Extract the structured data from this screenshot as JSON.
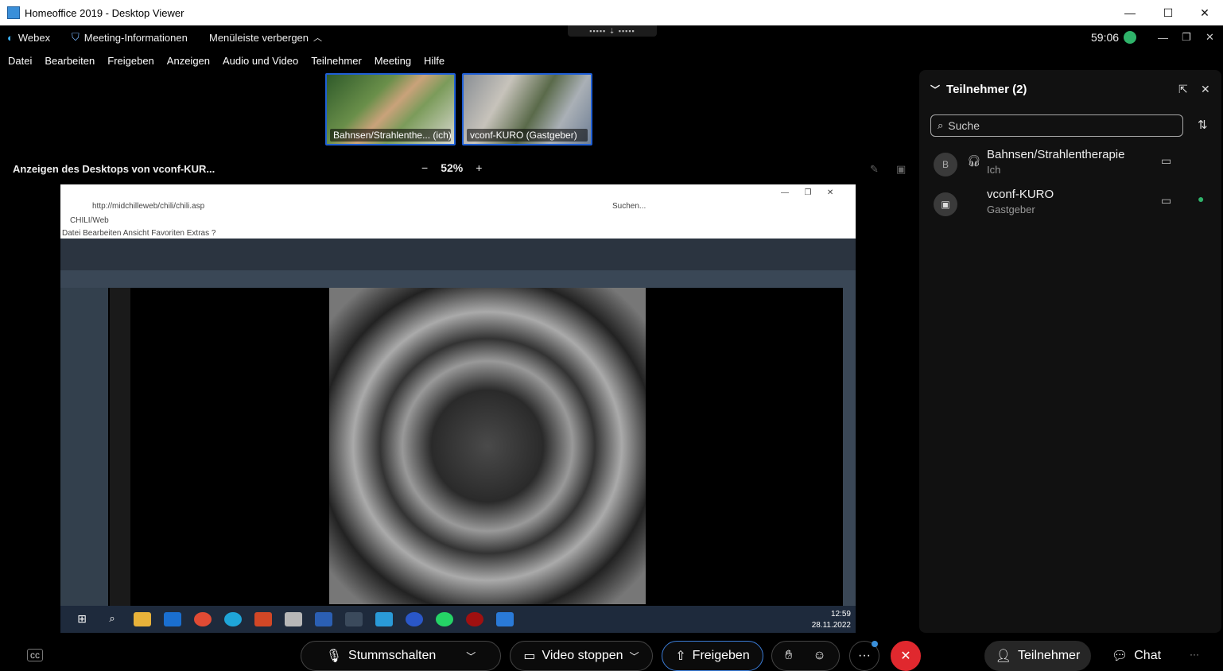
{
  "window": {
    "title": "Homeoffice 2019 - Desktop Viewer",
    "minimize": "—",
    "maximize": "☐",
    "close": "✕"
  },
  "webexbar": {
    "brand": "Webex",
    "meeting_info": "Meeting-Informationen",
    "hide_menu": "Menüleiste verbergen",
    "timer": "59:06"
  },
  "menu": [
    "Datei",
    "Bearbeiten",
    "Freigeben",
    "Anzeigen",
    "Audio und Video",
    "Teilnehmer",
    "Meeting",
    "Hilfe"
  ],
  "thumbnails": [
    {
      "label": "Bahnsen/Strahlenthe... (ich)"
    },
    {
      "label": "vconf-KURO (Gastgeber)"
    }
  ],
  "share": {
    "title": "Anzeigen des Desktops von vconf-KUR...",
    "zoom_out": "−",
    "zoom_level": "52%",
    "zoom_in": "+"
  },
  "shared_screen": {
    "url": "http://midchilleweb/chili/chili.asp",
    "app_title": "CHILI/Web",
    "search": "Suchen...",
    "menu": "Datei  Bearbeiten  Ansicht  Favoriten  Extras  ?",
    "clock_time": "12:59",
    "clock_date": "28.11.2022"
  },
  "panel": {
    "title": "Teilnehmer (2)",
    "search_placeholder": "Suche",
    "participants": [
      {
        "initial": "B",
        "name": "Bahnsen/Strahlentherapie",
        "role": "Ich"
      },
      {
        "initial": "",
        "name": "vconf-KURO",
        "role": "Gastgeber"
      }
    ]
  },
  "controls": {
    "mute": "Stummschalten",
    "video": "Video stoppen",
    "share": "Freigeben",
    "participants": "Teilnehmer",
    "chat": "Chat",
    "more": "···"
  },
  "colors": {
    "accent_blue": "#1f5fd6",
    "end_red": "#e0282e",
    "mic_green": "#2fb36a"
  }
}
